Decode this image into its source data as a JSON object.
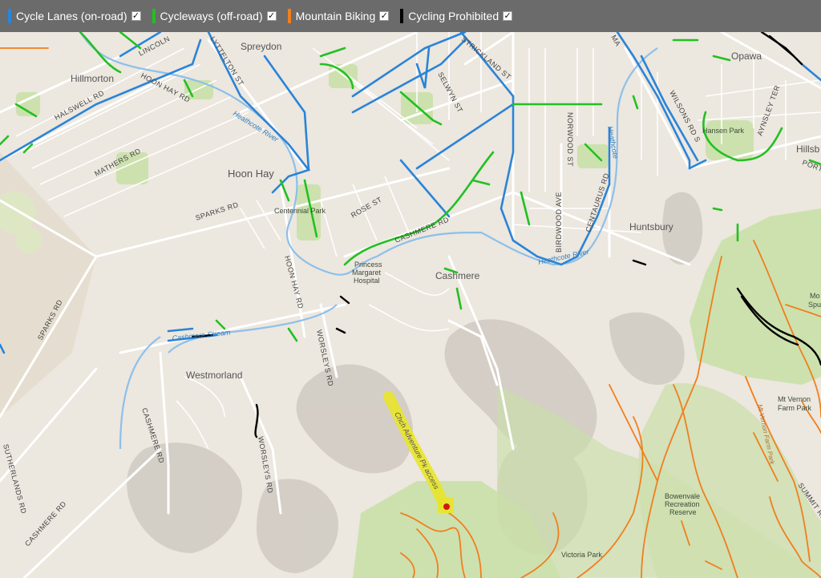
{
  "legend": {
    "items": [
      {
        "label": "Cycle Lanes (on-road)",
        "color": "#2a84d8",
        "checked": true
      },
      {
        "label": "Cycleways (off-road)",
        "color": "#22c022",
        "checked": true
      },
      {
        "label": "Mountain Biking",
        "color": "#f07f1d",
        "checked": true
      },
      {
        "label": "Cycling Prohibited",
        "color": "#000000",
        "checked": true
      }
    ],
    "check_glyph": "✓"
  },
  "map": {
    "places": {
      "spreydon": "Spreydon",
      "hillmorton": "Hillmorton",
      "opawa": "Opawa",
      "hoon_hay": "Hoon Hay",
      "hansen_park": "Hansen Park",
      "hillsb": "Hillsb",
      "centennial_park": "Centennial Park",
      "huntsbury": "Huntsbury",
      "princess_margaret_1": "Princess",
      "princess_margaret_2": "Margaret",
      "princess_margaret_3": "Hospital",
      "cashmere": "Cashmere",
      "westmorland": "Westmorland",
      "mt_vernon_1": "Mt Vernon",
      "mt_vernon_2": "Farm Park",
      "bowenvale_1": "Bowenvale",
      "bowenvale_2": "Recreation",
      "bowenvale_3": "Reserve",
      "victoria_park": "Victoria Park",
      "mo_1": "Mo",
      "mo_2": "Spu"
    },
    "roads": {
      "lincoln": "LINCOLN",
      "lyttelton": "LYTTELTON ST",
      "hoon_hay_rd_top": "HOON HAY RD",
      "halswell": "HALSWELL RD",
      "mathers": "MATHERS RD",
      "sparks_top": "SPARKS RD",
      "selwyn": "SELWYN ST",
      "strickland": "STRICKLAND ST",
      "norwood": "NORWOOD ST",
      "birdwood": "BIRDWOOD AVE",
      "centaurus": "CENTAURUS RD",
      "rose": "ROSE ST",
      "cashmere_rd": "CASHMERE RD",
      "hoon_hay_rd": "HOON HAY RD",
      "sparks_left": "SPARKS RD",
      "worsleys_top": "WORSLEYS RD",
      "worsleys_bottom": "WORSLEYS RD",
      "cashmere_rd_left": "CASHMERE RD",
      "cashmere_rd_bottom": "CASHMERE RD",
      "sutherlands": "SUTHERLANDS RD",
      "wilsons": "WILSONS RD S",
      "aynsley": "AYNSLEY TER",
      "port": "PORT",
      "summit": "SUMMIT RD",
      "ma": "MA"
    },
    "water": {
      "heathcote_1": "Heathcote River",
      "heathcote_2": "Heathcote",
      "heathcote_3": "Heathcote River",
      "cashmere_stream": "Cashmere Stream"
    },
    "tracks": {
      "adventure": "Chch Adventure Pk access",
      "mt_vernon_track": "Mt Vernon Farm Park"
    }
  },
  "colors": {
    "map_background": "#ece7df",
    "park_green": "#c8dfa6",
    "hill_shade": "#b9b2a8",
    "road": "#ffffff",
    "river": "#8cc0ea",
    "highlight": "#e9e42a"
  }
}
